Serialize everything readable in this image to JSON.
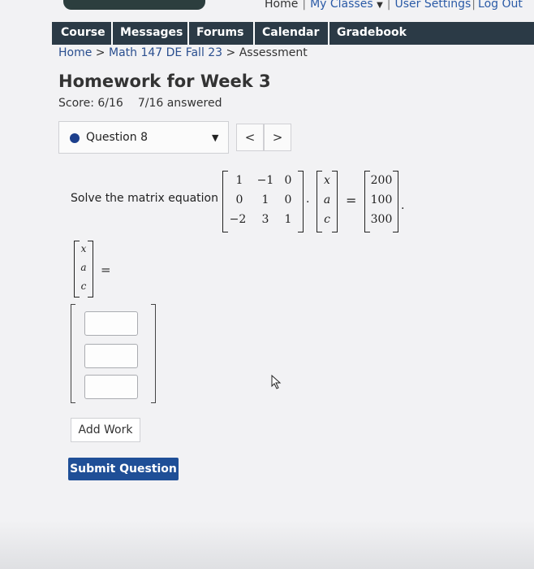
{
  "top_links": {
    "home": "Home",
    "my_classes": "My Classes",
    "user_settings": "User Settings",
    "log_out": "Log Out"
  },
  "nav": {
    "tabs": [
      {
        "label": "Course"
      },
      {
        "label": "Messages"
      },
      {
        "label": "Forums"
      },
      {
        "label": "Calendar"
      },
      {
        "label": "Gradebook"
      }
    ]
  },
  "breadcrumb": {
    "home": "Home",
    "course": "Math 147 DE Fall 23",
    "current": "Assessment",
    "separator": ">"
  },
  "assessment": {
    "title": "Homework for Week 3",
    "score": "Score: 6/16",
    "answered": "7/16 answered"
  },
  "question_selector": {
    "selected": "Question 8",
    "prev": "<",
    "next": ">"
  },
  "question": {
    "prompt": "Solve the matrix equation",
    "matrix_A": [
      [
        "1",
        "−1",
        "0"
      ],
      [
        "0",
        "1",
        "0"
      ],
      [
        "−2",
        "3",
        "1"
      ]
    ],
    "dot": "·",
    "variables": [
      "x",
      "a",
      "c"
    ],
    "equals": "=",
    "rhs": [
      "200",
      "100",
      "300"
    ],
    "period": "."
  },
  "answer": {
    "variables": [
      "x",
      "a",
      "c"
    ],
    "equals": "=",
    "inputs": [
      "",
      "",
      ""
    ]
  },
  "buttons": {
    "add_work": "Add Work",
    "submit": "Submit Question"
  },
  "colors": {
    "nav_bg": "#2b3a46",
    "submit_bg": "#1f4f97",
    "question_dot": "#1c3f8c"
  }
}
